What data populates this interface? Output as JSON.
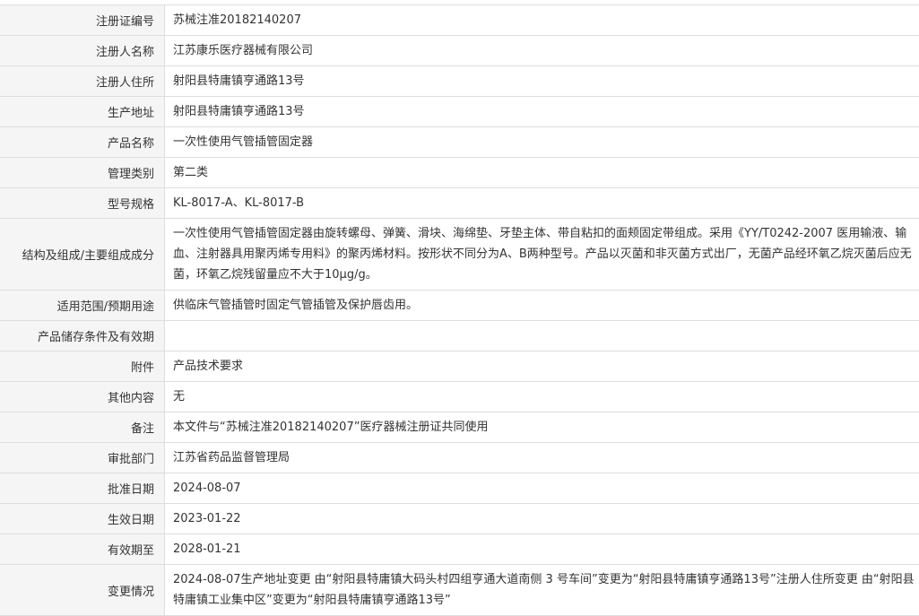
{
  "rows": [
    {
      "label": "注册证编号",
      "value": "苏械注准20182140207"
    },
    {
      "label": "注册人名称",
      "value": "江苏康乐医疗器械有限公司"
    },
    {
      "label": "注册人住所",
      "value": "射阳县特庸镇亨通路13号"
    },
    {
      "label": "生产地址",
      "value": "射阳县特庸镇亨通路13号"
    },
    {
      "label": "产品名称",
      "value": "一次性使用气管插管固定器"
    },
    {
      "label": "管理类别",
      "value": "第二类"
    },
    {
      "label": "型号规格",
      "value": "KL-8017-A、KL-8017-B"
    },
    {
      "label": "结构及组成/主要组成成分",
      "value": "一次性使用气管插管固定器由旋转螺母、弹簧、滑块、海绵垫、牙垫主体、带自粘扣的面颊固定带组成。采用《YY/T0242-2007 医用输液、输血、注射器具用聚丙烯专用料》的聚丙烯材料。按形状不同分为A、B两种型号。产品以灭菌和非灭菌方式出厂，无菌产品经环氧乙烷灭菌后应无菌，环氧乙烷残留量应不大于10μg/g。"
    },
    {
      "label": "适用范围/预期用途",
      "value": "供临床气管插管时固定气管插管及保护唇齿用。"
    },
    {
      "label": "产品储存条件及有效期",
      "value": ""
    },
    {
      "label": "附件",
      "value": "产品技术要求"
    },
    {
      "label": "其他内容",
      "value": "无"
    },
    {
      "label": "备注",
      "value": "本文件与“苏械注准20182140207”医疗器械注册证共同使用"
    },
    {
      "label": "审批部门",
      "value": "江苏省药品监督管理局"
    },
    {
      "label": "批准日期",
      "value": "2024-08-07"
    },
    {
      "label": "生效日期",
      "value": "2023-01-22"
    },
    {
      "label": "有效期至",
      "value": "2028-01-21"
    },
    {
      "label": "变更情况",
      "value": "2024-08-07生产地址变更 由“射阳县特庸镇大码头村四组亨通大道南侧 3 号车间”变更为“射阳县特庸镇亨通路13号”注册人住所变更 由“射阳县特庸镇工业集中区”变更为“射阳县特庸镇亨通路13号”"
    }
  ]
}
